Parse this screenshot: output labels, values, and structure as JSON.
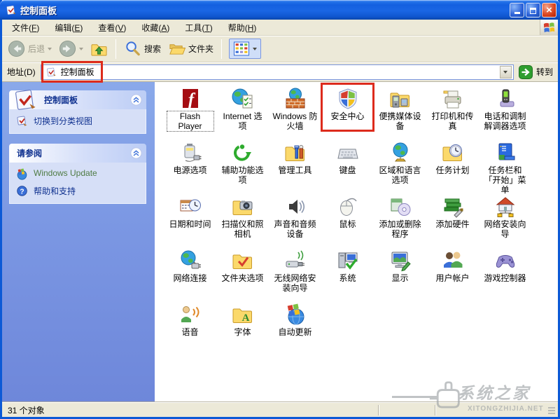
{
  "window": {
    "title": "控制面板"
  },
  "titlebar": {
    "buttons": [
      "minimize",
      "maximize",
      "close"
    ]
  },
  "menu": {
    "items": [
      "文件(F)",
      "编辑(E)",
      "查看(V)",
      "收藏(A)",
      "工具(T)",
      "帮助(H)"
    ]
  },
  "toolbar": {
    "back": "后退",
    "search": "搜索",
    "folders": "文件夹"
  },
  "address": {
    "label": "地址(D)",
    "value": "控制面板",
    "go": "转到"
  },
  "sidebar": {
    "panels": [
      {
        "title": "控制面板",
        "items": [
          {
            "label": "切换到分类视图",
            "icon": "switch-view",
            "color": "#0d2f8e"
          }
        ]
      },
      {
        "title": "请参阅",
        "items": [
          {
            "label": "Windows Update",
            "icon": "windows-update",
            "color": "#4f7b44"
          },
          {
            "label": "帮助和支持",
            "icon": "help",
            "color": "#0d2f8e"
          }
        ]
      }
    ]
  },
  "content": {
    "items": [
      {
        "label": "Flash Player",
        "icon": "flash-player",
        "selected": true
      },
      {
        "label": "Internet 选项",
        "icon": "internet-options"
      },
      {
        "label": "Windows 防火墙",
        "icon": "windows-firewall"
      },
      {
        "label": "安全中心",
        "icon": "security-center",
        "highlighted": true
      },
      {
        "label": "便携媒体设备",
        "icon": "portable-media"
      },
      {
        "label": "打印机和传真",
        "icon": "printers-faxes"
      },
      {
        "label": "电话和调制解调器选项",
        "icon": "phone-modem"
      },
      {
        "label": "电源选项",
        "icon": "power-options"
      },
      {
        "label": "辅助功能选项",
        "icon": "accessibility"
      },
      {
        "label": "管理工具",
        "icon": "admin-tools"
      },
      {
        "label": "键盘",
        "icon": "keyboard"
      },
      {
        "label": "区域和语言选项",
        "icon": "regional-language"
      },
      {
        "label": "任务计划",
        "icon": "task-scheduler"
      },
      {
        "label": "任务栏和「开始」菜单",
        "icon": "taskbar-startmenu"
      },
      {
        "label": "日期和时间",
        "icon": "date-time"
      },
      {
        "label": "扫描仪和照相机",
        "icon": "scanners-cameras"
      },
      {
        "label": "声音和音频设备",
        "icon": "sounds-audio"
      },
      {
        "label": "鼠标",
        "icon": "mouse"
      },
      {
        "label": "添加或删除程序",
        "icon": "add-remove-programs"
      },
      {
        "label": "添加硬件",
        "icon": "add-hardware"
      },
      {
        "label": "网络安装向导",
        "icon": "network-setup-wizard"
      },
      {
        "label": "网络连接",
        "icon": "network-connections"
      },
      {
        "label": "文件夹选项",
        "icon": "folder-options"
      },
      {
        "label": "无线网络安装向导",
        "icon": "wireless-setup-wizard"
      },
      {
        "label": "系统",
        "icon": "system"
      },
      {
        "label": "显示",
        "icon": "display"
      },
      {
        "label": "用户帐户",
        "icon": "user-accounts"
      },
      {
        "label": "游戏控制器",
        "icon": "game-controllers"
      },
      {
        "label": "语音",
        "icon": "speech"
      },
      {
        "label": "字体",
        "icon": "fonts"
      },
      {
        "label": "自动更新",
        "icon": "automatic-updates"
      }
    ]
  },
  "statusbar": {
    "text": "31 个对象"
  },
  "watermark": {
    "title": "系统之家",
    "url": "XITONGZHIJIA.NET"
  },
  "colors": {
    "annotation": "#dd2b1c",
    "titlebar": "#1460e0",
    "chrome": "#ece9d8",
    "sidebar_link": "#0d2f8e"
  }
}
